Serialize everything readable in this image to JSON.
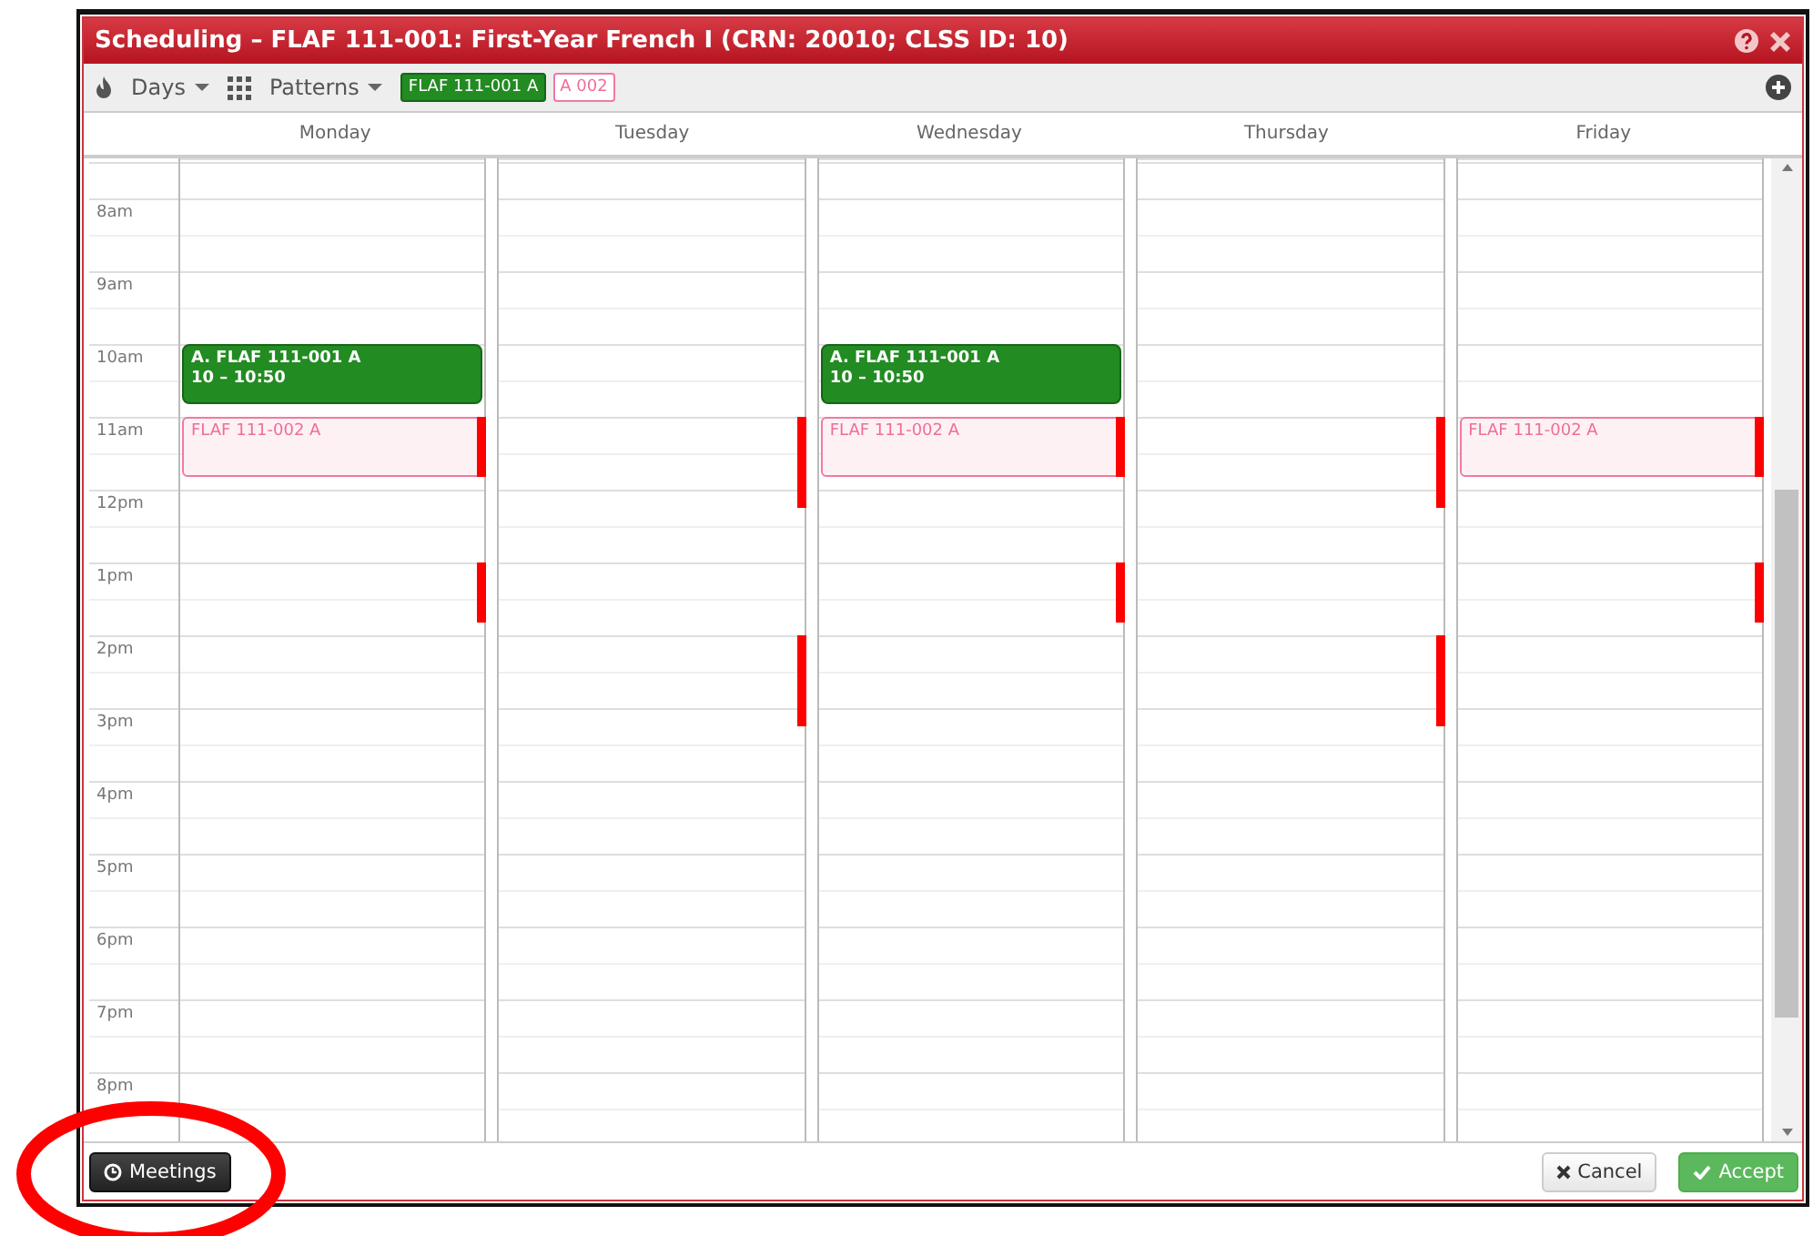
{
  "window": {
    "title": "Scheduling – FLAF 111-001: First-Year French I (CRN: 20010; CLSS ID: 10)"
  },
  "toolbar": {
    "days_menu": "Days",
    "patterns_menu": "Patterns",
    "tags": [
      {
        "label": "FLAF 111-001 A",
        "kind": "assigned"
      },
      {
        "label": "A 002",
        "kind": "option"
      }
    ]
  },
  "days": [
    "Monday",
    "Tuesday",
    "Wednesday",
    "Thursday",
    "Friday"
  ],
  "hours": [
    {
      "label": "8am"
    },
    {
      "label": "9am"
    },
    {
      "label": "10am",
      "events": {
        "monday": [
          {
            "kind": "assigned",
            "title": "A. FLAF 111-001 A",
            "time": "10 – 10:50"
          }
        ],
        "wednesday": [
          {
            "kind": "assigned",
            "title": "A. FLAF 111-001 A",
            "time": "10 – 10:50"
          }
        ]
      }
    },
    {
      "label": "11am",
      "events": {
        "monday": [
          {
            "kind": "option",
            "title": "FLAF 111-002 A"
          },
          {
            "kind": "conflict",
            "long": false
          }
        ],
        "tuesday": [
          {
            "kind": "conflict",
            "long": true
          }
        ],
        "wednesday": [
          {
            "kind": "option",
            "title": "FLAF 111-002 A"
          },
          {
            "kind": "conflict",
            "long": false
          }
        ],
        "thursday": [
          {
            "kind": "conflict",
            "long": true
          }
        ],
        "friday": [
          {
            "kind": "option",
            "title": "FLAF 111-002 A"
          },
          {
            "kind": "conflict",
            "long": false
          }
        ]
      }
    },
    {
      "label": "12pm"
    },
    {
      "label": "1pm",
      "events": {
        "monday": [
          {
            "kind": "conflict",
            "long": false
          }
        ],
        "wednesday": [
          {
            "kind": "conflict",
            "long": false
          }
        ],
        "friday": [
          {
            "kind": "conflict",
            "long": false
          }
        ]
      }
    },
    {
      "label": "2pm",
      "events": {
        "tuesday": [
          {
            "kind": "conflict",
            "long": true
          }
        ],
        "thursday": [
          {
            "kind": "conflict",
            "long": true
          }
        ]
      }
    },
    {
      "label": "3pm"
    },
    {
      "label": "4pm"
    },
    {
      "label": "5pm"
    },
    {
      "label": "6pm"
    },
    {
      "label": "7pm"
    },
    {
      "label": "8pm"
    }
  ],
  "footer": {
    "meetings_button": {
      "label": "Meetings",
      "circled": true
    },
    "cancel_button": "Cancel",
    "accept_button": "Accept"
  }
}
